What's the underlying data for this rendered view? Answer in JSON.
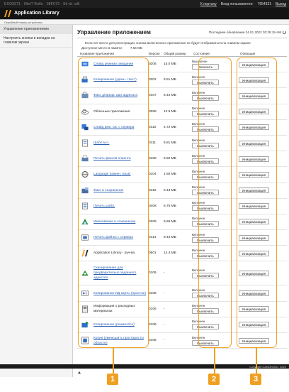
{
  "topbar": {
    "crumbs": "ESO3071 · Nlet? Rolle · 98F073 · Sti-rb rulli",
    "portal_link": "К порталу",
    "login_label": "Вход пользователя:",
    "login_value": "7654321",
    "logout_link": "Выход"
  },
  "header": {
    "title": "Application Library"
  },
  "subbar": {
    "text": "Серийный номер устройства"
  },
  "sidebar": {
    "items": [
      {
        "label": "Управление приложениями"
      },
      {
        "label": "Настроить кнопки и вкладки на главном экране"
      }
    ]
  },
  "main": {
    "title": "Управление приложением",
    "updated": "Последнее обновление 24.01 2022 03:25:19 AM",
    "note": "Если нет места для регистрации, кнопка включенного приложения не будет отображаться на главном экране",
    "memory_label": "Доступное место в памяти",
    "memory_value": "7.54 МБ"
  },
  "table": {
    "headers": {
      "app": "Название приложения",
      "version": "Версия",
      "size": "Общий размер",
      "state": "Состояние",
      "operation": "Операция"
    },
    "rows": [
      {
        "name": "Слайд режима ожидания",
        "version": "0206",
        "size": "15.0 МБ",
        "state": "Выключен",
        "toggle": "Включить",
        "init": "Инициализация",
        "icon": "standby-slide-icon",
        "linked": true
      },
      {
        "name": "Копирование (удачн. текст)",
        "version": "0302",
        "size": "6.51 МБ",
        "state": "Включен",
        "toggle": "Выключить",
        "init": "Инициализация",
        "icon": "copy-icon",
        "linked": true
      },
      {
        "name": "Факс д/предв. вдн адресата",
        "version": "0107",
        "size": "6.44 МБ",
        "state": "Включен",
        "toggle": "Выключить",
        "init": "Инициализация",
        "icon": "fax-icon",
        "linked": true
      },
      {
        "name": "Облачные приложения",
        "version": "3058",
        "size": "12.9 МБ",
        "state": "Включен",
        "toggle": "Выключить",
        "init": "Инициализация",
        "icon": "cloud-icon",
        "linked": false
      },
      {
        "name": "Слайд реж. ож. с сервера",
        "version": "0110",
        "size": "4.72 МБ",
        "state": "Включен",
        "toggle": "Выключить",
        "init": "Инициализация",
        "icon": "server-slide-icon",
        "linked": true
      },
      {
        "name": "Шабл.м.о.",
        "version": "0111",
        "size": "6.81 МБ",
        "state": "Включен",
        "toggle": "Выключить",
        "init": "Инициализация",
        "icon": "template-icon",
        "linked": true
      },
      {
        "name": "Печать факсов клиента",
        "version": "0108",
        "size": "5.92 МБ",
        "state": "Включен",
        "toggle": "Выключить",
        "init": "Инициализация",
        "icon": "fax-print-icon",
        "linked": true
      },
      {
        "name": "Language (измен. язык)",
        "version": "0104",
        "size": "1.92 МБ",
        "state": "Включен",
        "toggle": "Выключить",
        "init": "Инициализация",
        "icon": "language-icon",
        "linked": true
      },
      {
        "name": "Факс и сохранение",
        "version": "0110",
        "size": "6.44 МБ",
        "state": "Включен",
        "toggle": "Выключить",
        "init": "Инициализация",
        "icon": "fax-store-icon",
        "linked": true
      },
      {
        "name": "Печать шабл.",
        "version": "0408",
        "size": "6.75 МБ",
        "state": "Включен",
        "toggle": "Выключить",
        "init": "Инициализация",
        "icon": "print-template-icon",
        "linked": true
      },
      {
        "name": "Именование и сохранение",
        "version": "0209",
        "size": "6.65 МБ",
        "state": "Включен",
        "toggle": "Выключить",
        "init": "Инициализация",
        "icon": "name-save-icon",
        "linked": true
      },
      {
        "name": "Печать файлы с сервера",
        "version": "0114",
        "size": "9.44 МБ",
        "state": "Включен",
        "toggle": "Выключить",
        "init": "Инициализация",
        "icon": "server-print-icon",
        "linked": true
      },
      {
        "name": "Application Library - руч-ва",
        "version": "0601",
        "size": "14.4 МБ",
        "state": "Включен",
        "toggle": "Выключить",
        "init": "Инициализация",
        "icon": "app-library-icon",
        "linked": false
      },
      {
        "name": "Сканирование для предварительно заданного адресата",
        "version": "0106",
        "size": "-",
        "state": "Включен",
        "toggle": "Выключить",
        "init": "Инициализация",
        "icon": "scan-icon",
        "linked": true,
        "tall": true
      },
      {
        "name": "Копирование ИД карты (простое)",
        "version": "0106",
        "size": "-",
        "state": "Включен",
        "toggle": "Выключить",
        "init": "Инициализация",
        "icon": "id-copy-icon",
        "linked": true
      },
      {
        "name": "Информация о расходных материалах",
        "version": "0106",
        "size": "-",
        "state": "Включен",
        "toggle": "Выключить",
        "init": "Инициализация",
        "icon": "supplies-icon",
        "linked": false
      },
      {
        "name": "Копирование (режим Eco)",
        "version": "0106",
        "size": "-",
        "state": "Включен",
        "toggle": "Выключить",
        "init": "Инициализация",
        "icon": "eco-copy-icon",
        "linked": true
      },
      {
        "name": "Копия (уменьшить простарнсты области)",
        "version": "0106",
        "size": "-",
        "state": "Включен",
        "toggle": "Выключить",
        "init": "Инициализация",
        "icon": "reduce-copy-icon",
        "linked": true
      }
    ]
  },
  "footer": {
    "copyright": "Copyright CANON INC. 2022"
  },
  "callouts": [
    "1",
    "2",
    "3"
  ],
  "colors": {
    "accent": "#f0a020",
    "link": "#2a5fb0",
    "header_bg": "#141414"
  }
}
